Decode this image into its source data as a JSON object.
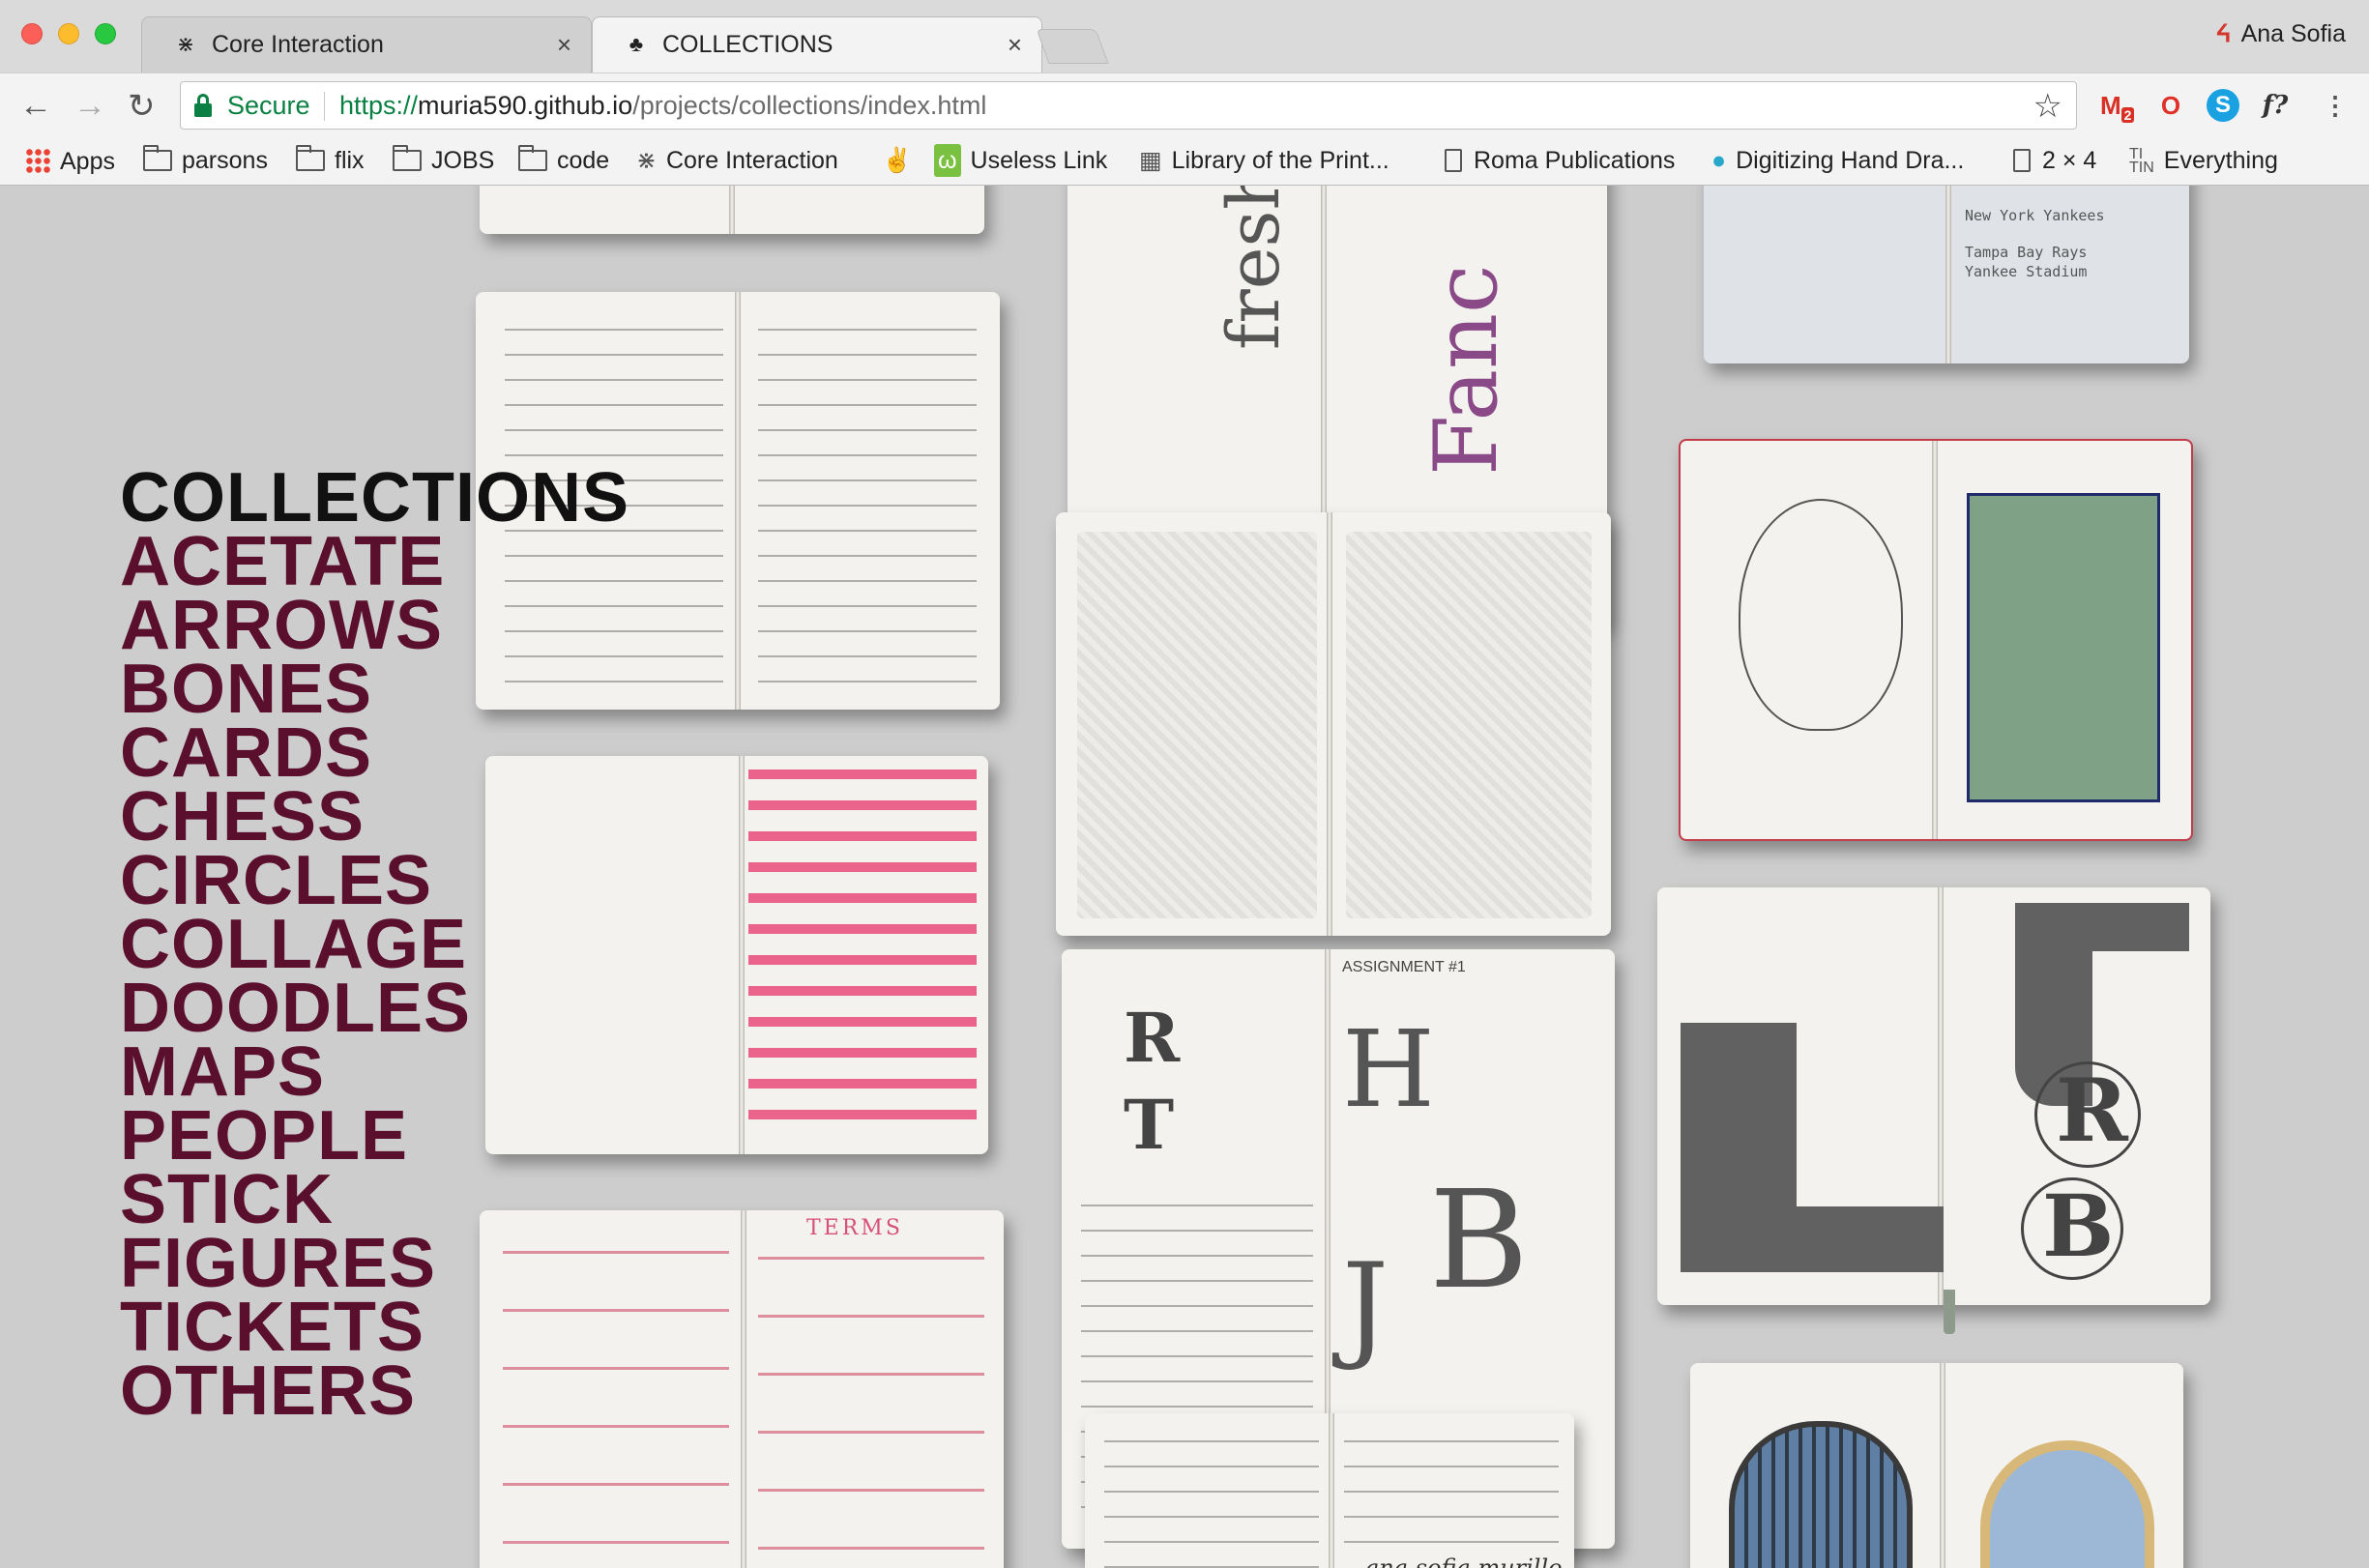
{
  "browser": {
    "tabs": [
      {
        "title": "Core Interaction",
        "icon": "ant-icon",
        "active": false
      },
      {
        "title": "COLLECTIONS",
        "icon": "pineapple-icon",
        "active": true
      }
    ],
    "profile_name": "Ana Sofia",
    "security_label": "Secure",
    "url_scheme": "https://",
    "url_host": "muria590.github.io",
    "url_path": "/projects/collections/index.html",
    "gmail_badge": "2",
    "fx_label": "f?",
    "bookmarks": [
      {
        "label": "Apps",
        "icon": "apps-grid-icon"
      },
      {
        "label": "parsons",
        "icon": "folder-icon"
      },
      {
        "label": "flix",
        "icon": "folder-icon"
      },
      {
        "label": "JOBS",
        "icon": "folder-icon"
      },
      {
        "label": "code",
        "icon": "folder-icon"
      },
      {
        "label": "Core Interaction",
        "icon": "ant-icon"
      },
      {
        "label": "",
        "icon": "peace-hand-icon"
      },
      {
        "label": "Useless Link",
        "icon": "useless-link-icon"
      },
      {
        "label": "Library of the Print...",
        "icon": "library-icon"
      },
      {
        "label": "Roma Publications",
        "icon": "document-icon"
      },
      {
        "label": "Digitizing Hand Dra...",
        "icon": "circle-icon"
      },
      {
        "label": "2 × 4",
        "icon": "document-icon"
      },
      {
        "label": "Everything",
        "icon": "ti-tin-icon"
      }
    ]
  },
  "page": {
    "title": "COLLECTIONS",
    "nav": [
      "ACETATE",
      "ARROWS",
      "BONES",
      "CARDS",
      "CHESS",
      "CIRCLES",
      "COLLAGE",
      "DOODLES",
      "MAPS",
      "PEOPLE",
      "STICK",
      "FIGURES",
      "TICKETS",
      "OTHERS"
    ],
    "sketch_text": {
      "terms_heading": "TERMS",
      "ticket_team": "New York Yankees",
      "ticket_opponent": "Tampa Bay Rays",
      "ticket_venue": "Yankee Stadium",
      "assignment": "ASSIGNMENT #1",
      "signature": "ana sofia murillo",
      "type_words": [
        "fresh",
        "Fanc"
      ],
      "letters": [
        "R",
        "T",
        "H",
        "B",
        "J",
        "R",
        "B"
      ]
    }
  },
  "colors": {
    "nav_link": "#5a0f2c",
    "nav_title": "#111111",
    "secure_green": "#0b8043",
    "page_bg": "#cdcdcd"
  }
}
